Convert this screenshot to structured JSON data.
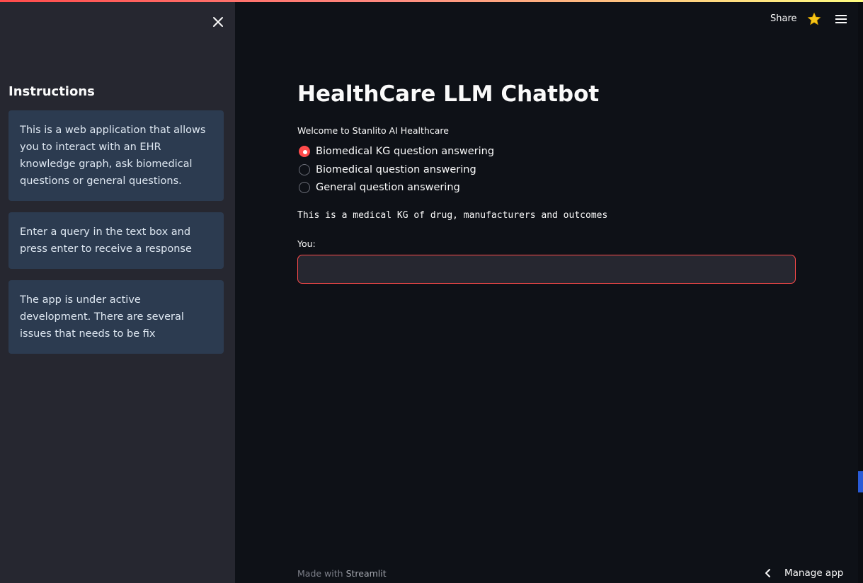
{
  "sidebar": {
    "heading": "Instructions",
    "boxes": [
      "This is a web application that allows you to interact with an EHR knowledge graph, ask biomedical questions or general questions.",
      "Enter a query in the text box and press enter to receive a response",
      "The app is under active development. There are several issues that needs to be fix"
    ]
  },
  "header": {
    "share_label": "Share",
    "star_icon": "star-icon",
    "menu_icon": "hamburger-menu-icon"
  },
  "main": {
    "title": "HealthCare LLM Chatbot",
    "welcome": "Welcome to Stanlito AI Healthcare",
    "radio_options": [
      "Biomedical KG question answering",
      "Biomedical question answering",
      "General question answering"
    ],
    "selected_option": "Biomedical KG question answering",
    "description": "This is a medical KG of drug, manufacturers and outcomes",
    "input_label": "You:",
    "input_value": ""
  },
  "footer": {
    "made_with": "Made with",
    "brand": "Streamlit",
    "manage_app": "Manage app"
  },
  "colors": {
    "accent": "#ff4b4b",
    "background": "#0e1117",
    "sidebar": "#262730",
    "info_box": "#2c3b50",
    "star": "#f5c518"
  }
}
